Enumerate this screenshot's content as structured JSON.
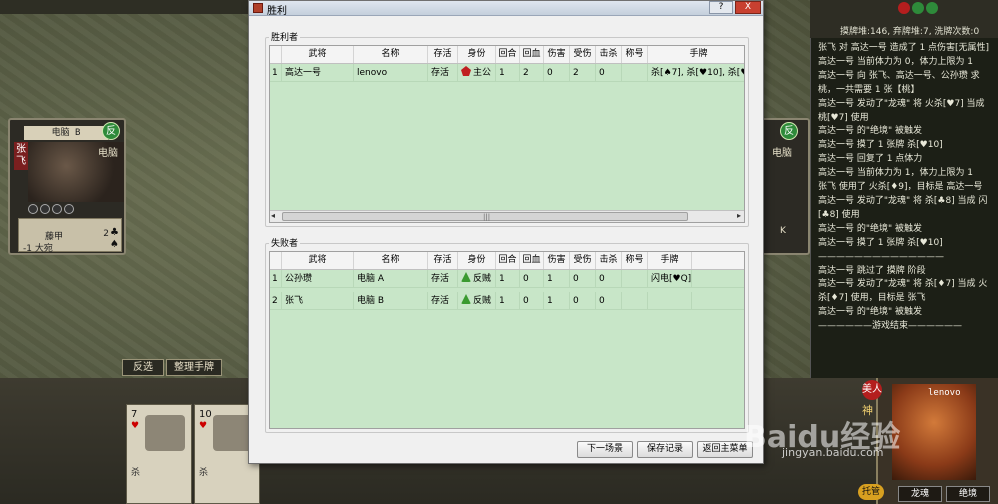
{
  "dialog": {
    "title": "胜利",
    "help_btn": "?",
    "close_btn": "X",
    "winners_label": "胜利者",
    "losers_label": "失败者",
    "actions": [
      "下一场景",
      "保存记录",
      "返回主菜单"
    ]
  },
  "columns": [
    "武将",
    "名称",
    "存活",
    "身份",
    "回合",
    "回血",
    "伤害",
    "受伤",
    "击杀",
    "称号",
    "手牌"
  ],
  "winners": [
    {
      "idx": "1",
      "general": "高达一号",
      "name": "lenovo",
      "alive": "存活",
      "role": "主公",
      "turns": "1",
      "heal": "2",
      "damage": "0",
      "hurt": "2",
      "kills": "0",
      "title": "",
      "hand": "杀[♠7], 杀[♥10], 杀[♥1"
    }
  ],
  "losers": [
    {
      "idx": "1",
      "general": "公孙瓒",
      "name": "电脑 A",
      "alive": "存活",
      "role": "反贼",
      "turns": "1",
      "heal": "0",
      "damage": "1",
      "hurt": "0",
      "kills": "0",
      "title": "",
      "hand": "闪电[♥Q]"
    },
    {
      "idx": "2",
      "general": "张飞",
      "name": "电脑 B",
      "alive": "存活",
      "role": "反贼",
      "turns": "1",
      "heal": "0",
      "damage": "1",
      "hurt": "0",
      "kills": "0",
      "title": "",
      "hand": ""
    }
  ],
  "game": {
    "left_card": {
      "title": "电脑 B",
      "kingdom": "反",
      "general": "张飞",
      "controller": "电脑",
      "armor": "藤甲",
      "horse": "-1 大宛",
      "armor_num": "2"
    },
    "right_card": {
      "kingdom": "反",
      "controller": "电脑",
      "num": "K"
    },
    "buttons": [
      "反选",
      "整理手牌"
    ],
    "hand_cards": [
      {
        "value": "7",
        "suit": "♥",
        "label": "杀"
      },
      {
        "value": "10",
        "suit": "♥",
        "label": "杀"
      },
      {
        "value": "",
        "suit": "",
        "label": ""
      }
    ],
    "player": {
      "name": "lenovo",
      "kingdom": "美人",
      "god": "神",
      "tuoguan": "托管",
      "skills": [
        "龙魂",
        "绝境"
      ]
    }
  },
  "log": {
    "deck_info": "摸牌堆:146, 弃牌堆:7, 洗牌次数:0",
    "lines": [
      "张飞 对 高达一号 造成了 1 点伤害[无属性]",
      "高达一号 当前体力为 0，体力上限为 1",
      "高达一号 向 张飞、高达一号、公孙瓒 求桃，一共需要 1 张【桃】",
      "高达一号 发动了\"龙魂\" 将 火杀[♥7] 当成 桃[♥7] 使用",
      "高达一号 的\"绝境\" 被触发",
      "高达一号 摸了 1 张牌 杀[♥10]",
      "高达一号 回复了 1 点体力",
      "高达一号 当前体力为 1，体力上限为 1",
      "张飞 使用了 火杀[♦9]，目标是 高达一号",
      "高达一号 发动了\"龙魂\" 将 杀[♣8] 当成 闪[♣8] 使用",
      "高达一号 的\"绝境\" 被触发",
      "高达一号 摸了 1 张牌 杀[♥10]",
      "——————————————",
      "高达一号 跳过了 摸牌 阶段",
      "高达一号 发动了\"龙魂\" 将 杀[♦7] 当成 火杀[♦7] 使用，目标是 张飞",
      "高达一号 的\"绝境\" 被触发",
      "——————游戏结束——————"
    ]
  },
  "watermark": {
    "main": "Baidu经验",
    "sub": "jingyan.baidu.com"
  }
}
